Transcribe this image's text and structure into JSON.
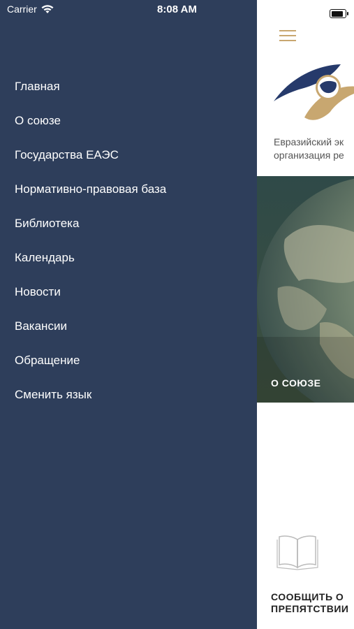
{
  "status_bar": {
    "carrier": "Carrier",
    "time": "8:08 AM"
  },
  "menu": {
    "items": [
      "Главная",
      "О союзе",
      "Государства ЕАЭС",
      "Нормативно-правовая база",
      "Библиотека",
      "Календарь",
      "Новости",
      "Вакансии",
      "Обращение",
      "Сменить язык"
    ]
  },
  "main": {
    "org_line1": "Евразийский эк",
    "org_line2": "организация ре",
    "hero_label": "О СОЮЗЕ",
    "report_line1": "СООБЩИТЬ О",
    "report_line2": "ПРЕПЯТСТВИИ"
  },
  "colors": {
    "drawer_bg": "#2e3e5b",
    "accent_gold": "#c8a770",
    "logo_navy": "#263a6b"
  }
}
